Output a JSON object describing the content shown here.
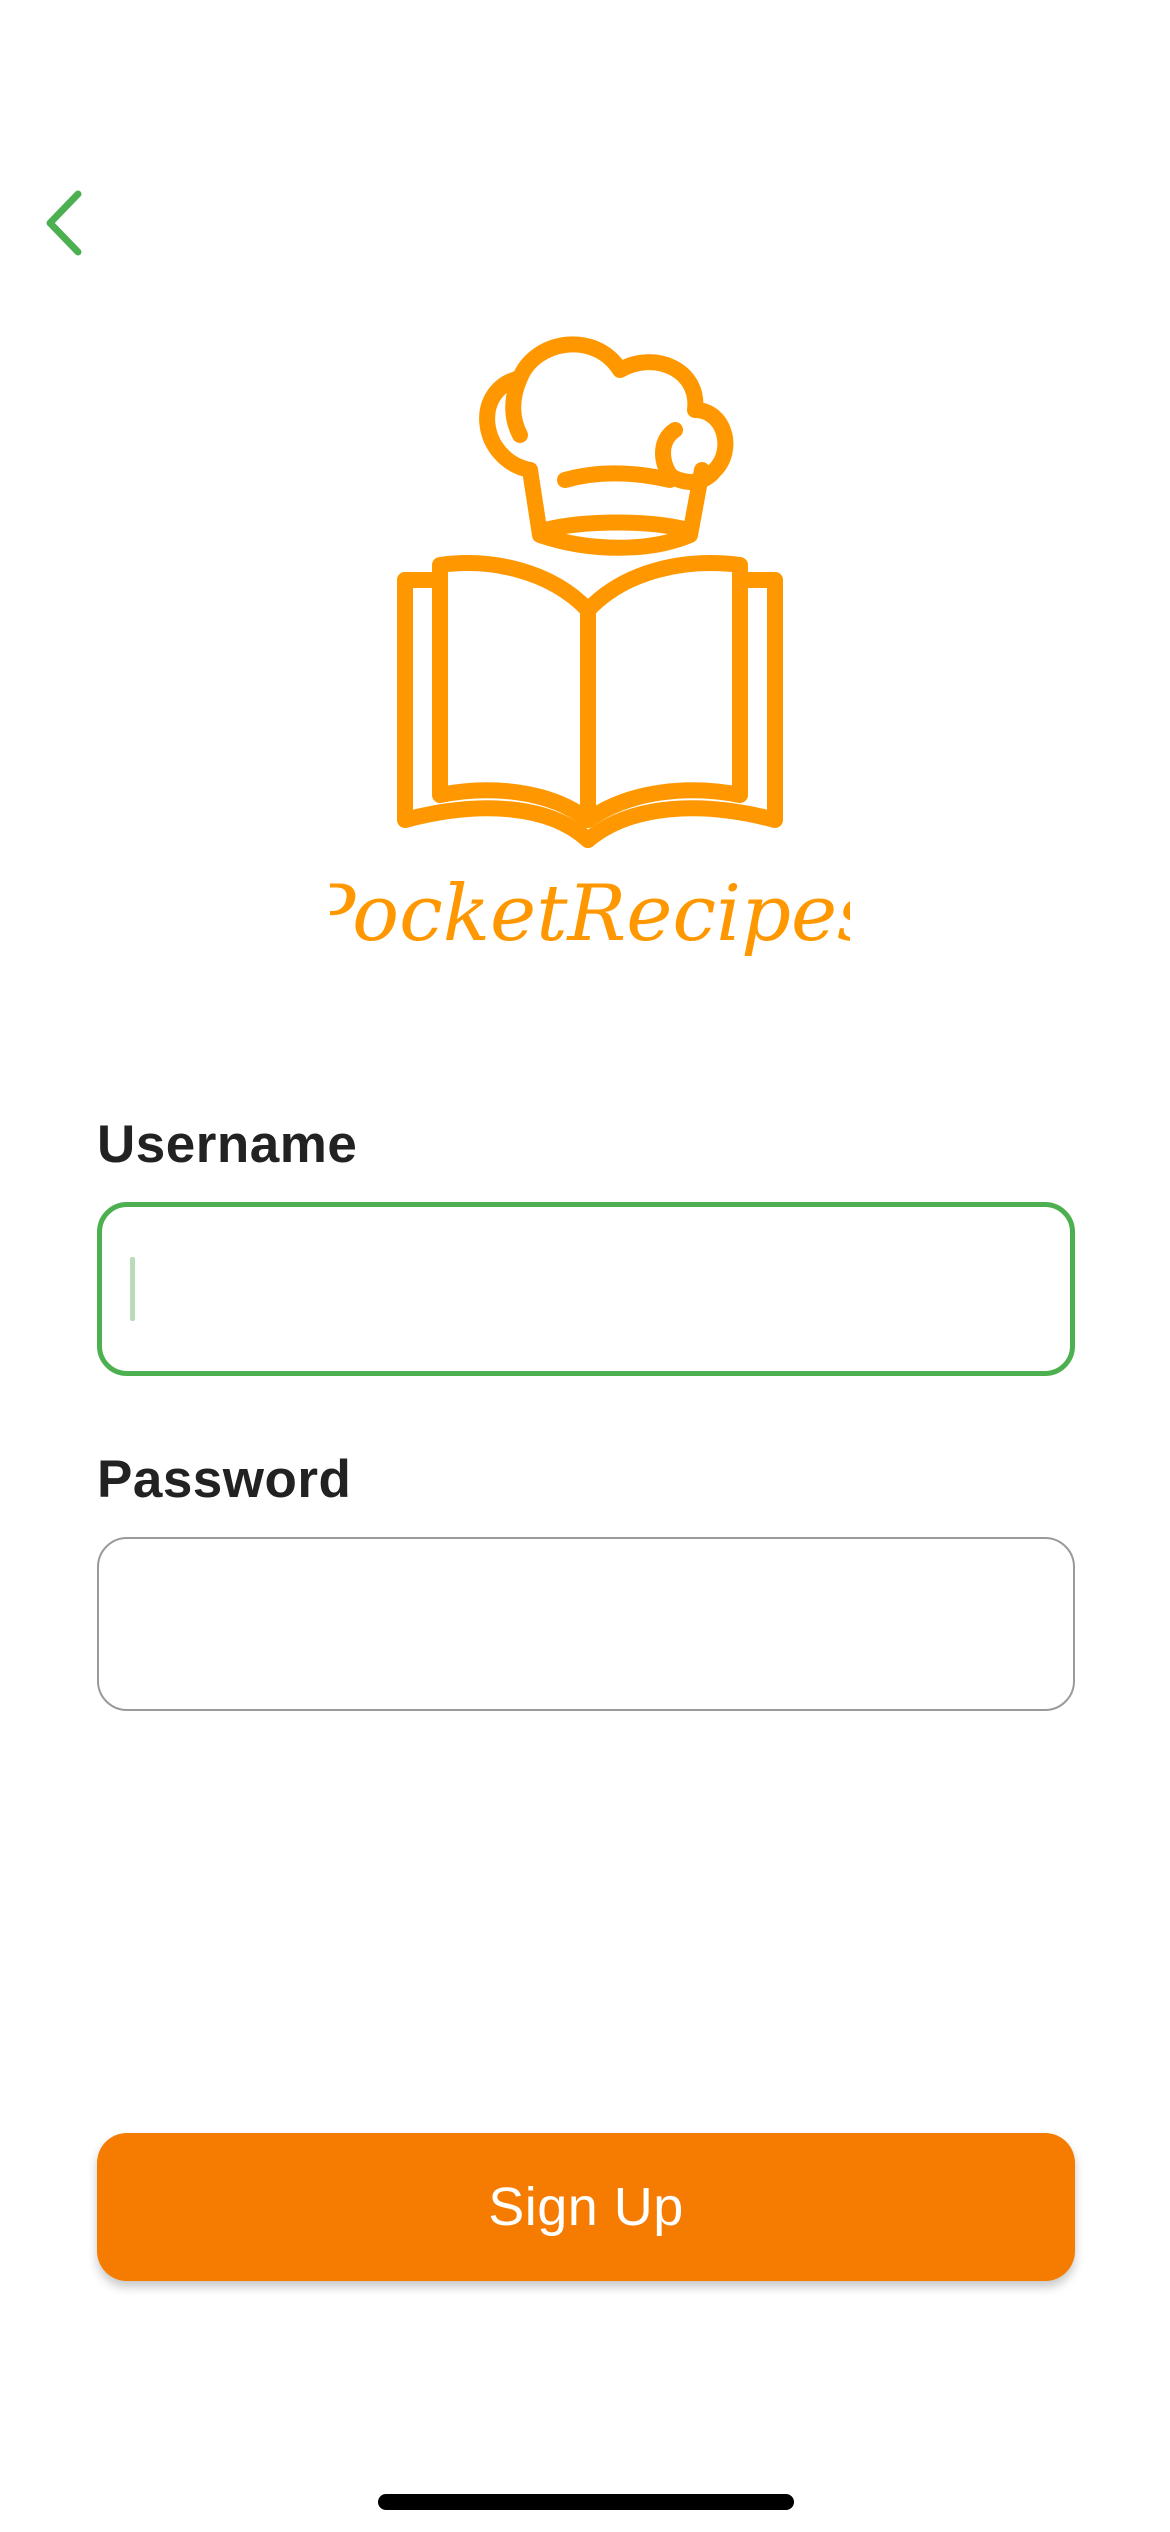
{
  "header": {
    "back_icon": "chevron-left-icon"
  },
  "logo": {
    "wordmark": "PocketRecipes",
    "icon": "chef-hat-book-icon"
  },
  "form": {
    "username_label": "Username",
    "username_value": "",
    "password_label": "Password",
    "password_value": ""
  },
  "actions": {
    "signup_label": "Sign Up"
  },
  "colors": {
    "accent_green": "#4caf50",
    "brand_orange": "#f57c00",
    "logo_orange": "#ff9800"
  }
}
